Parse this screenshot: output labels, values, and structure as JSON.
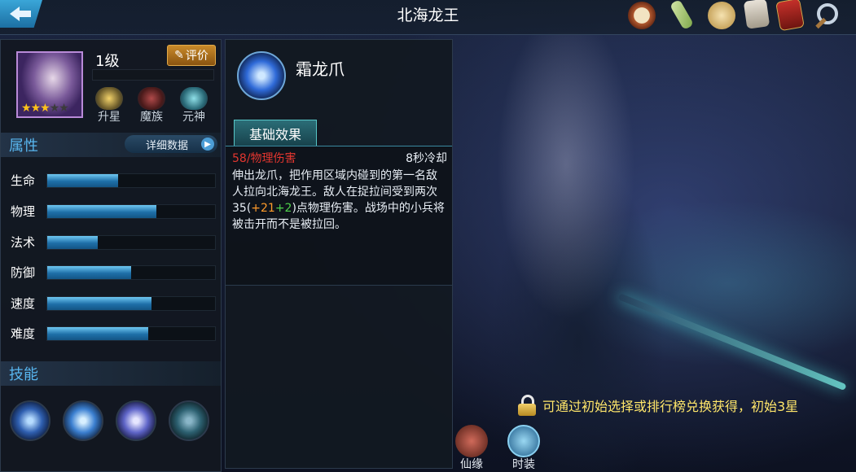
{
  "header": {
    "title": "北海龙王"
  },
  "hero": {
    "level": "1级",
    "rate_label": "评价",
    "stars_on": 3,
    "stars_total": 5
  },
  "hero_actions": [
    {
      "label": "升星"
    },
    {
      "label": "魔族"
    },
    {
      "label": "元神"
    }
  ],
  "attributes": {
    "heading": "属性",
    "detail_label": "详细数据",
    "stats": [
      {
        "name": "生命",
        "value": 0.42
      },
      {
        "name": "物理",
        "value": 0.65
      },
      {
        "name": "法术",
        "value": 0.3
      },
      {
        "name": "防御",
        "value": 0.5
      },
      {
        "name": "速度",
        "value": 0.62
      },
      {
        "name": "难度",
        "value": 0.6
      }
    ]
  },
  "skills_section": {
    "heading": "技能"
  },
  "skill": {
    "name": "霜龙爪",
    "tab": "基础效果",
    "damage": "58/物理伤害",
    "cooldown": "8秒冷却",
    "desc_1": "伸出龙爪，把作用区域内碰到的第一名敌人拉向北海龙王。敌人在捉拉间受到两次35(",
    "desc_plus1": "+21",
    "desc_plus2": "+2",
    "desc_2": ")点物理伤害。战场中的小兵将被击开而不是被拉回。"
  },
  "unlock": {
    "text": "可通过初始选择或排行榜兑换获得，初始3星"
  },
  "bottom_tabs": [
    {
      "label": "仙缘"
    },
    {
      "label": "时装"
    }
  ]
}
